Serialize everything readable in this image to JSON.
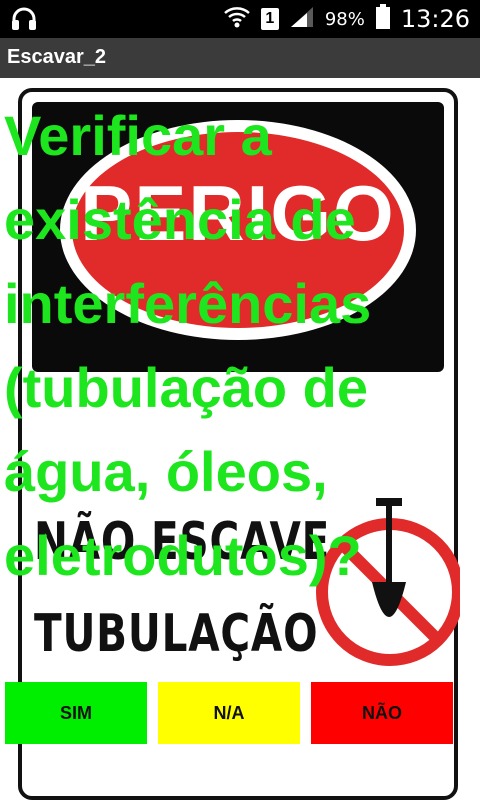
{
  "status_bar": {
    "headphones_icon": "headphones-icon",
    "wifi_icon": "wifi-icon",
    "sim_slot": "1",
    "signal_icon": "signal-icon",
    "battery_percent": "98%",
    "battery_icon": "battery-icon",
    "time": "13:26"
  },
  "title_bar": {
    "title": "Escavar_2"
  },
  "sign": {
    "danger_word": "PERIGO",
    "warning_line1": "NÃO ESCAVE",
    "warning_line2": "TUBULAÇÃO"
  },
  "question": "Verificar a existência de interferências (tubulação de água, óleos, eletrodutos)?",
  "buttons": {
    "sim": "SIM",
    "na": "N/A",
    "nao": "NÃO"
  },
  "colors": {
    "question_text": "#1ee61e",
    "sim_button": "#00ee00",
    "na_button": "#ffff00",
    "nao_button": "#ff0000",
    "title_bar_bg": "#3b3b3b"
  }
}
